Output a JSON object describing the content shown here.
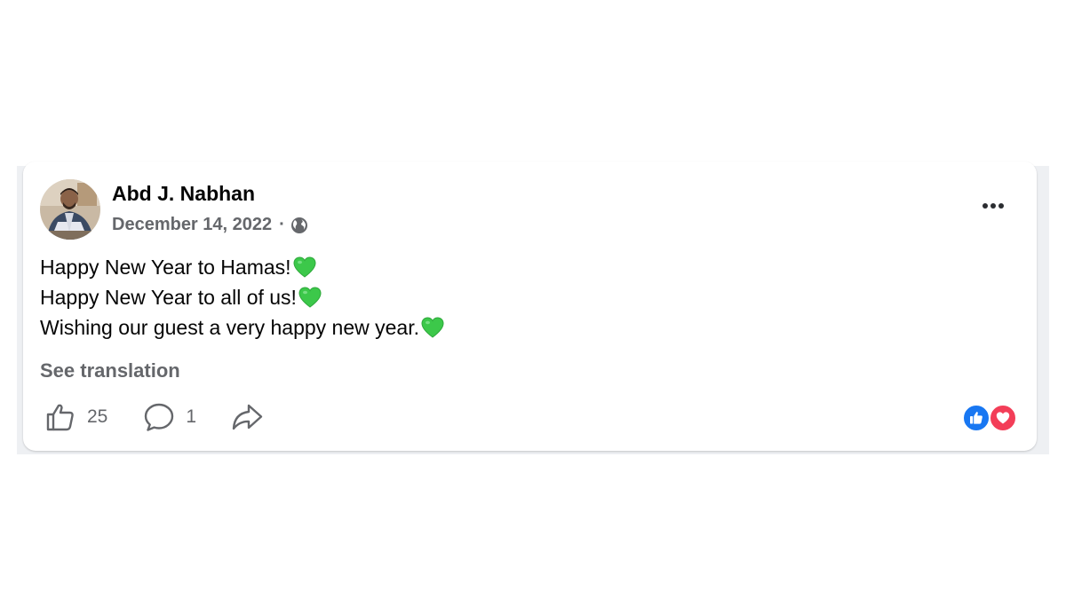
{
  "post": {
    "author": "Abd J. Nabhan",
    "date": "December 14, 2022",
    "separator": "·",
    "audience_icon": "globe-icon",
    "lines": [
      "Happy New Year to Hamas!",
      "Happy New Year to all of us!",
      "Wishing our guest a very happy new year."
    ],
    "line_emoji": "green-heart-icon",
    "see_translation": "See translation"
  },
  "actions": {
    "like_count": "25",
    "comment_count": "1"
  },
  "reactions": [
    "like-reaction-icon",
    "love-reaction-icon"
  ],
  "colors": {
    "like_blue": "#1877f2",
    "love_red": "#f33e58",
    "secondary_text": "#65676b",
    "heart_green": "#3cc84a"
  }
}
